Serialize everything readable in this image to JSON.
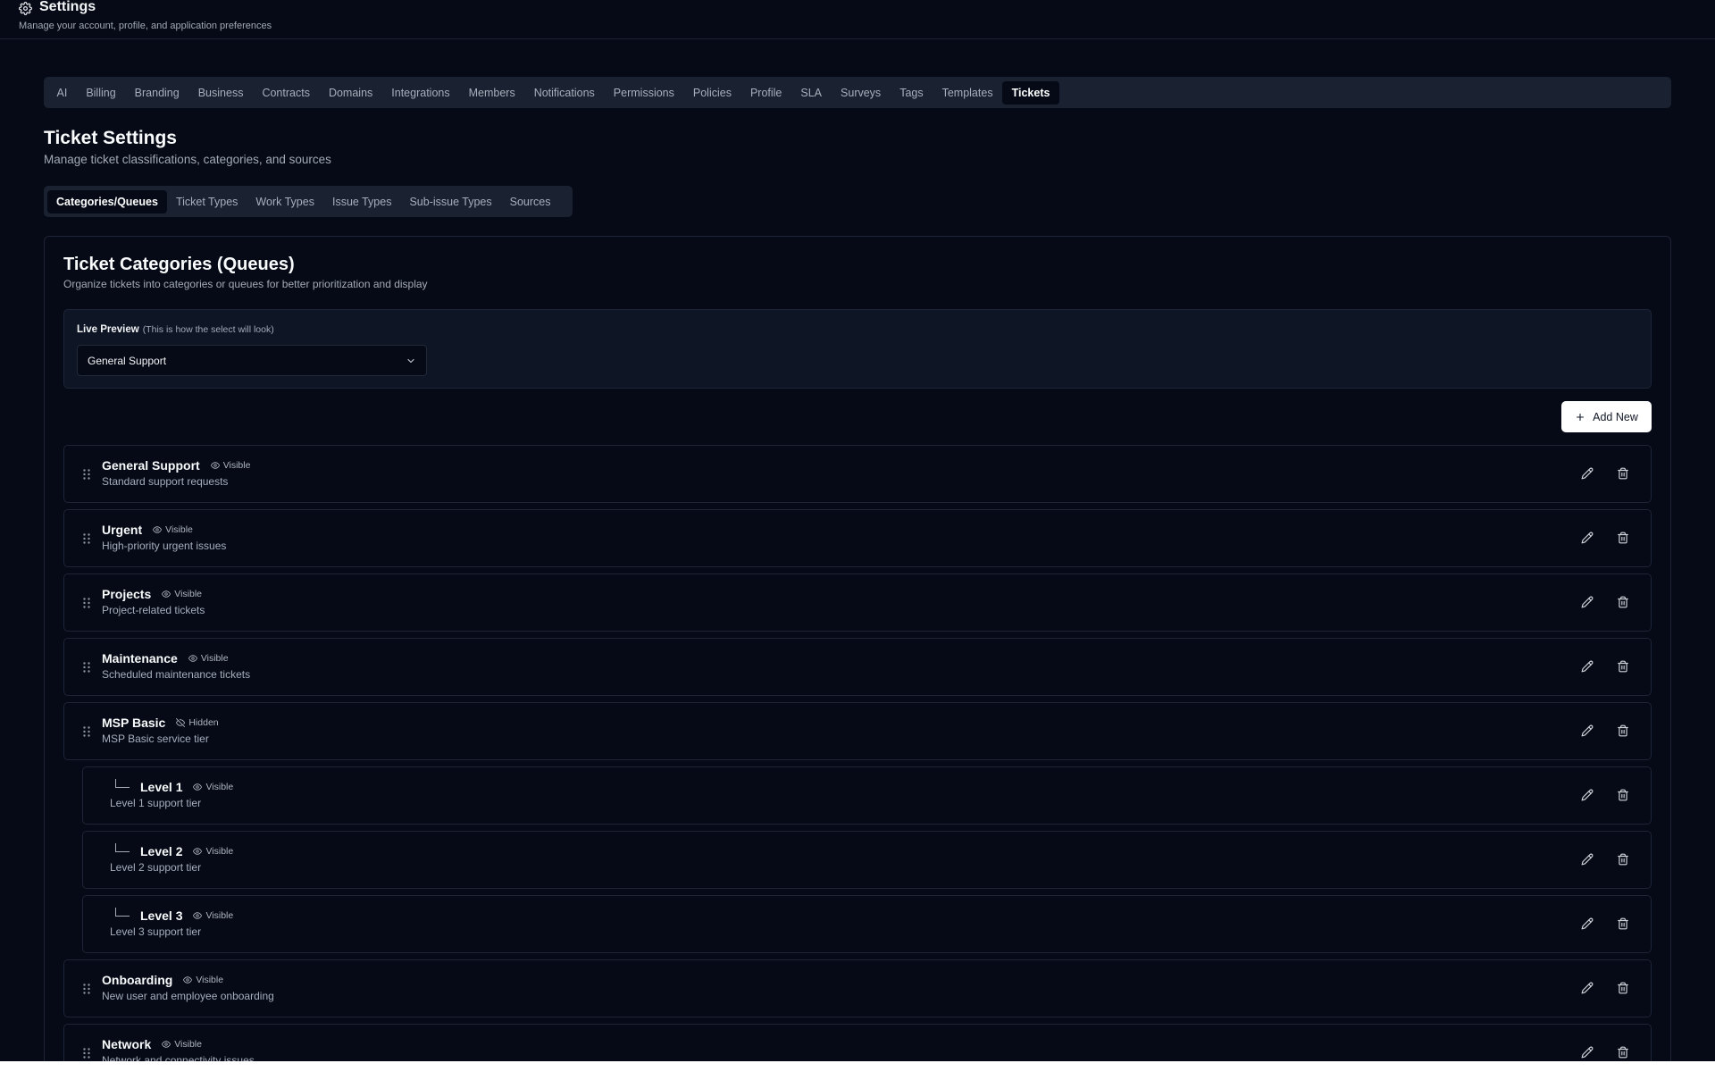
{
  "header": {
    "title": "Settings",
    "subtitle": "Manage your account, profile, and application preferences"
  },
  "main_tabs": [
    {
      "label": "AI",
      "active": false
    },
    {
      "label": "Billing",
      "active": false
    },
    {
      "label": "Branding",
      "active": false
    },
    {
      "label": "Business",
      "active": false
    },
    {
      "label": "Contracts",
      "active": false
    },
    {
      "label": "Domains",
      "active": false
    },
    {
      "label": "Integrations",
      "active": false
    },
    {
      "label": "Members",
      "active": false
    },
    {
      "label": "Notifications",
      "active": false
    },
    {
      "label": "Permissions",
      "active": false
    },
    {
      "label": "Policies",
      "active": false
    },
    {
      "label": "Profile",
      "active": false
    },
    {
      "label": "SLA",
      "active": false
    },
    {
      "label": "Surveys",
      "active": false
    },
    {
      "label": "Tags",
      "active": false
    },
    {
      "label": "Templates",
      "active": false
    },
    {
      "label": "Tickets",
      "active": true
    }
  ],
  "section": {
    "title": "Ticket Settings",
    "subtitle": "Manage ticket classifications, categories, and sources"
  },
  "sub_tabs": [
    {
      "label": "Categories/Queues",
      "active": true
    },
    {
      "label": "Ticket Types",
      "active": false
    },
    {
      "label": "Work Types",
      "active": false
    },
    {
      "label": "Issue Types",
      "active": false
    },
    {
      "label": "Sub-issue Types",
      "active": false
    },
    {
      "label": "Sources",
      "active": false
    }
  ],
  "card": {
    "title": "Ticket Categories (Queues)",
    "subtitle": "Organize tickets into categories or queues for better prioritization and display"
  },
  "preview": {
    "label": "Live Preview",
    "hint": "(This is how the select will look)",
    "selected": "General Support"
  },
  "add_button": {
    "label": "Add New"
  },
  "categories": [
    {
      "name": "General Support",
      "status": "Visible",
      "description": "Standard support requests",
      "child": false
    },
    {
      "name": "Urgent",
      "status": "Visible",
      "description": "High-priority urgent issues",
      "child": false
    },
    {
      "name": "Projects",
      "status": "Visible",
      "description": "Project-related tickets",
      "child": false
    },
    {
      "name": "Maintenance",
      "status": "Visible",
      "description": "Scheduled maintenance tickets",
      "child": false
    },
    {
      "name": "MSP Basic",
      "status": "Hidden",
      "description": "MSP Basic service tier",
      "child": false
    },
    {
      "name": "Level 1",
      "status": "Visible",
      "description": "Level 1 support tier",
      "child": true
    },
    {
      "name": "Level 2",
      "status": "Visible",
      "description": "Level 2 support tier",
      "child": true
    },
    {
      "name": "Level 3",
      "status": "Visible",
      "description": "Level 3 support tier",
      "child": true
    },
    {
      "name": "Onboarding",
      "status": "Visible",
      "description": "New user and employee onboarding",
      "child": false
    },
    {
      "name": "Network",
      "status": "Visible",
      "description": "Network and connectivity issues",
      "child": false
    }
  ],
  "icons": {
    "settings": "gear-icon",
    "dropdown": "chevron-down-icon",
    "add": "plus-icon",
    "drag": "drag-handle-icon",
    "visible": "eye-icon",
    "hidden": "eye-off-icon",
    "edit": "pencil-icon",
    "delete": "trash-icon"
  },
  "colors": {
    "background": "#050a16",
    "tab_bar": "#1a2130",
    "border": "#1e2536",
    "text_primary": "#f9fafb",
    "text_muted": "#a3aab6",
    "button_bg": "#ffffff"
  }
}
